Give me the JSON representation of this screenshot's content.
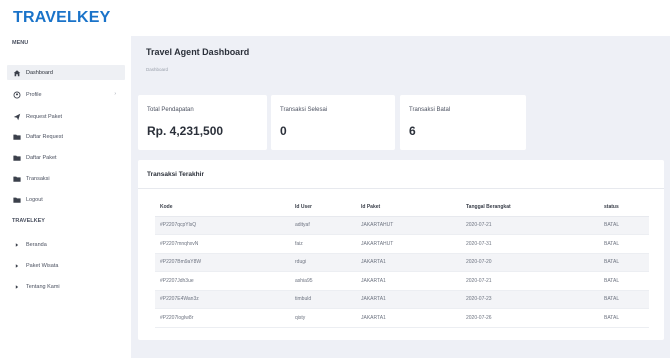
{
  "app": {
    "brand": "TRAVELKEY"
  },
  "sidebar": {
    "menu_label": "MENU",
    "items": [
      {
        "label": "Dashboard",
        "icon": "home-icon",
        "active": true
      },
      {
        "label": "Profile",
        "icon": "user-icon",
        "has_submenu": true
      },
      {
        "label": "Request Paket",
        "icon": "send-icon"
      },
      {
        "label": "Daftar Request",
        "icon": "folder-icon"
      },
      {
        "label": "Daftar Paket",
        "icon": "folder-icon"
      },
      {
        "label": "Transaksi",
        "icon": "folder-icon"
      },
      {
        "label": "Logout",
        "icon": "folder-icon"
      }
    ],
    "section2_label": "TRAVELKEY",
    "links": [
      {
        "label": "Beranda"
      },
      {
        "label": "Paket Wisata"
      },
      {
        "label": "Tentang Kami"
      }
    ],
    "arrow_glyph": "›"
  },
  "header": {
    "title": "Travel Agent Dashboard",
    "breadcrumb": "Dashboard"
  },
  "stats": [
    {
      "label": "Total Pendapatan",
      "value": "Rp. 4,231,500"
    },
    {
      "label": "Transaksi Selesai",
      "value": "0"
    },
    {
      "label": "Transaksi Batal",
      "value": "6"
    }
  ],
  "transactions": {
    "title": "Transaksi Terakhir",
    "columns": [
      "Kode",
      "Id User",
      "Id Paket",
      "Tanggal Berangkat",
      "status"
    ],
    "rows": [
      [
        "#P2207qcpYlsQ",
        "adityaf",
        "JAKARTAHUT",
        "2020-07-21",
        "BATAL"
      ],
      [
        "#P2207mnqhxvN",
        "faiz",
        "JAKARTAHUT",
        "2020-07-31",
        "BATAL"
      ],
      [
        "#P2207Bm9aY8W",
        "rdugi",
        "JAKARTA1",
        "2020-07-20",
        "BATAL"
      ],
      [
        "#P2207Jdh3ue",
        "ashia95",
        "JAKARTA1",
        "2020-07-21",
        "BATAL"
      ],
      [
        "#P2207E4Wan3z",
        "timbuld",
        "JAKARTA1",
        "2020-07-23",
        "BATAL"
      ],
      [
        "#P2207logIw8r",
        "qisty",
        "JAKARTA1",
        "2020-07-26",
        "BATAL"
      ]
    ]
  },
  "colors": {
    "brand": "#1a73c9",
    "background": "#eef0f6",
    "card": "#ffffff"
  }
}
